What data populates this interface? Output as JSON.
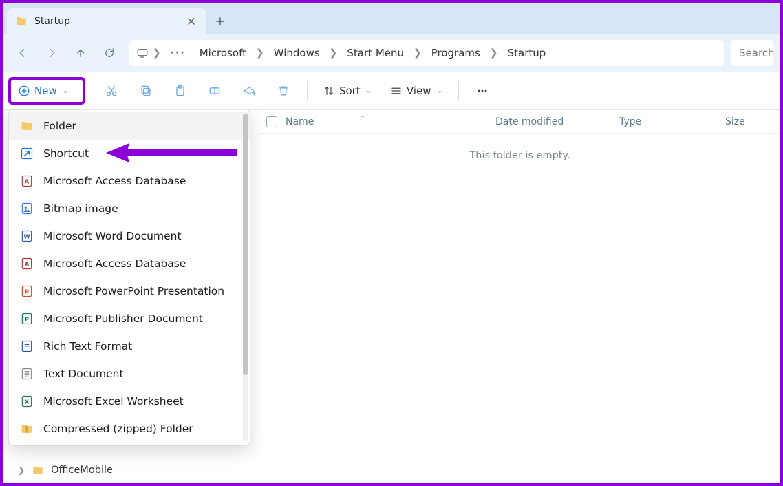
{
  "colors": {
    "highlight": "#8a00d6",
    "accent": "#1976d2"
  },
  "tab": {
    "title": "Startup"
  },
  "breadcrumbs": [
    "Microsoft",
    "Windows",
    "Start Menu",
    "Programs",
    "Startup"
  ],
  "search": {
    "placeholder": "Search"
  },
  "toolbar": {
    "new_label": "New",
    "sort_label": "Sort",
    "view_label": "View"
  },
  "new_menu": [
    {
      "label": "Folder",
      "icon": "folder"
    },
    {
      "label": "Shortcut",
      "icon": "shortcut"
    },
    {
      "label": "Microsoft Access Database",
      "icon": "access"
    },
    {
      "label": "Bitmap image",
      "icon": "bitmap"
    },
    {
      "label": "Microsoft Word Document",
      "icon": "word"
    },
    {
      "label": "Microsoft Access Database",
      "icon": "access-alt"
    },
    {
      "label": "Microsoft PowerPoint Presentation",
      "icon": "powerpoint"
    },
    {
      "label": "Microsoft Publisher Document",
      "icon": "publisher"
    },
    {
      "label": "Rich Text Format",
      "icon": "rtf"
    },
    {
      "label": "Text Document",
      "icon": "text"
    },
    {
      "label": "Microsoft Excel Worksheet",
      "icon": "excel"
    },
    {
      "label": "Compressed (zipped) Folder",
      "icon": "zip"
    }
  ],
  "tree": {
    "visible_item": "OfficeMobile"
  },
  "columns": {
    "name": "Name",
    "date": "Date modified",
    "type": "Type",
    "size": "Size"
  },
  "content": {
    "empty_message": "This folder is empty."
  },
  "annotation": {
    "arrow_target": "Shortcut"
  }
}
